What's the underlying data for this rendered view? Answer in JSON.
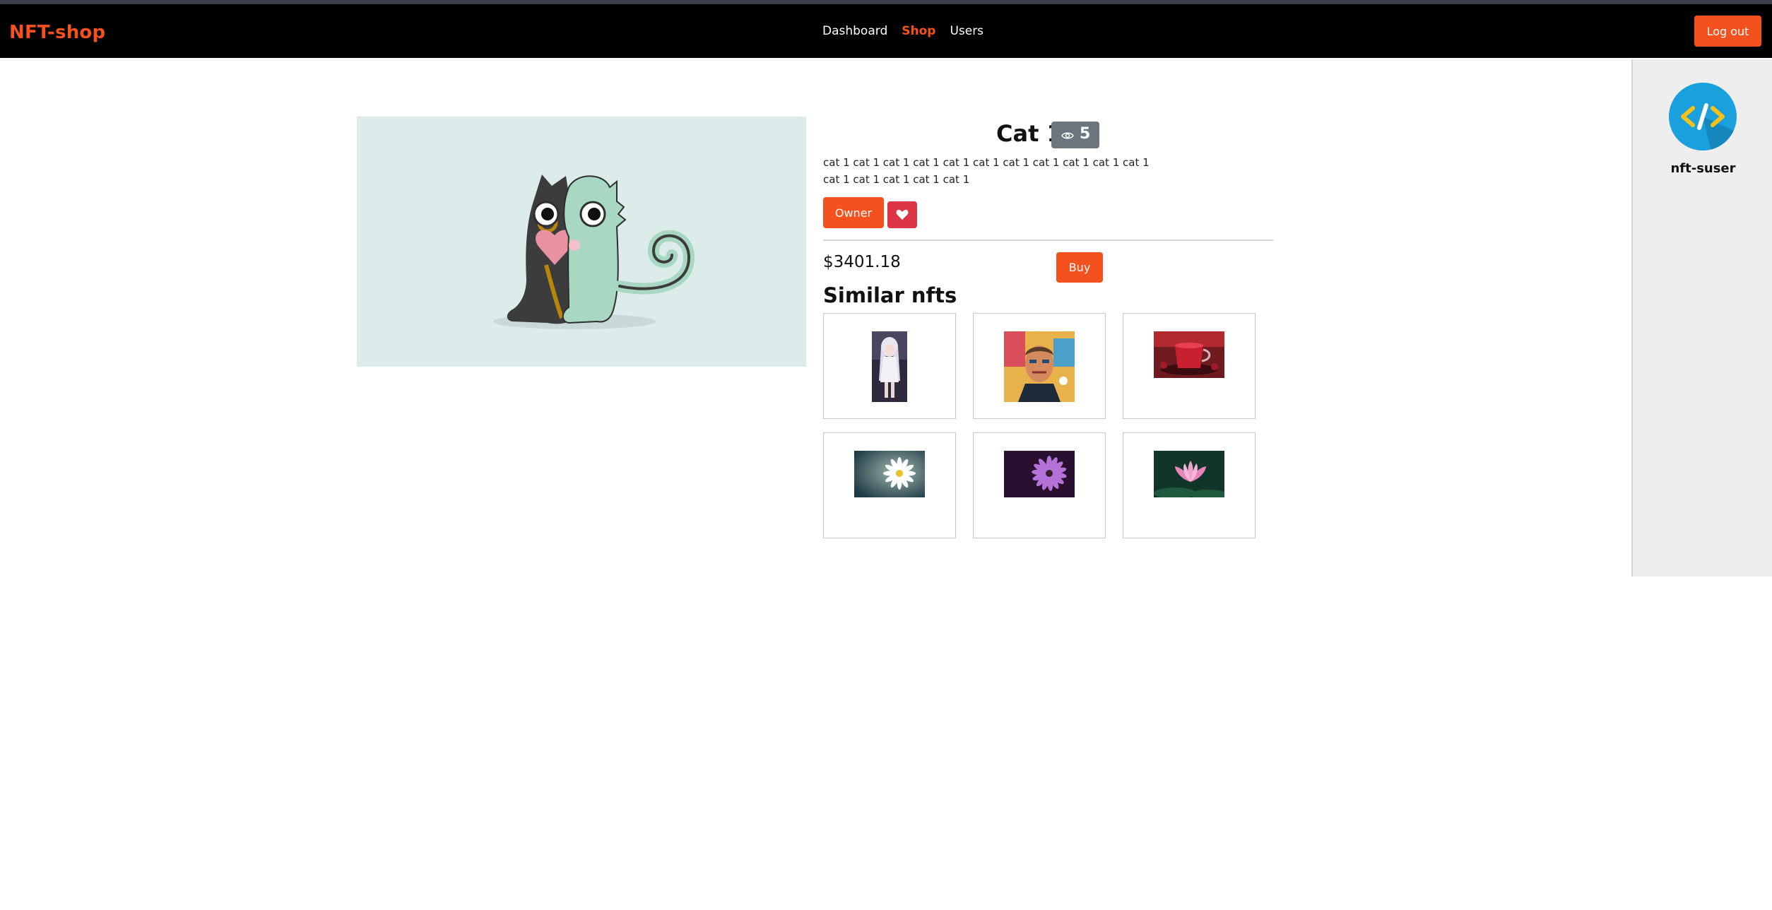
{
  "navbar": {
    "brand": "NFT-shop",
    "links": [
      "Dashboard",
      "Shop",
      "Users"
    ],
    "active_link": "Shop",
    "logout_label": "Log out"
  },
  "sidebar": {
    "username": "nft-suser",
    "avatar_icon": "code-brackets-icon"
  },
  "nft": {
    "title": "Cat 1",
    "views": "5",
    "description": "cat 1 cat 1 cat 1 cat 1 cat 1 cat 1 cat 1 cat 1 cat 1 cat 1 cat 1 cat 1 cat 1 cat 1 cat 1 cat 1",
    "owner_label": "Owner",
    "price": "$3401.18",
    "buy_label": "Buy"
  },
  "similar": {
    "title": "Similar nfts",
    "items": [
      {
        "subject": "anime-girl"
      },
      {
        "subject": "pop-art-portrait"
      },
      {
        "subject": "red-tea"
      },
      {
        "subject": "white-daisy"
      },
      {
        "subject": "purple-flower"
      },
      {
        "subject": "pink-lotus"
      }
    ]
  },
  "colors": {
    "accent": "#f4511e",
    "navbar_bg": "#000000",
    "badge_bg": "#6c757d",
    "like_bg": "#dc3545",
    "image_bg": "#dbecea",
    "sidebar_bg": "#eeeeee"
  }
}
